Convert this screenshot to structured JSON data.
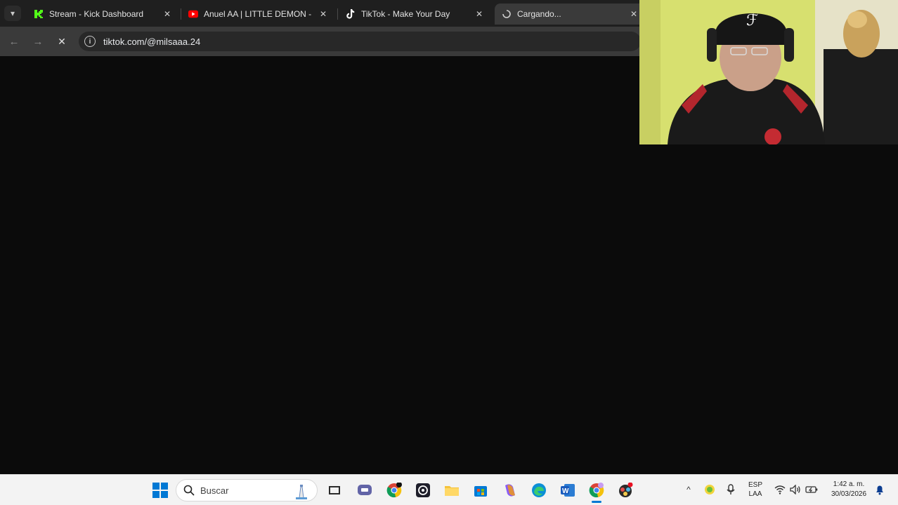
{
  "browser": {
    "tabs": [
      {
        "title": "Stream - Kick Dashboard",
        "favicon": "kick-logo-icon"
      },
      {
        "title": "Anuel AA | LITTLE DEMON - You",
        "favicon": "youtube-logo-icon"
      },
      {
        "title": "TikTok - Make Your Day",
        "favicon": "tiktok-logo-icon"
      },
      {
        "title": "Cargando...",
        "favicon": "loading-spinner-icon"
      }
    ],
    "address": "tiktok.com/@milsaaa.24"
  },
  "taskbar": {
    "search_placeholder": "Buscar",
    "language": "ESP",
    "layout": "LAA",
    "time": "1:42 a. m.",
    "date": "30/03/2026"
  },
  "colors": {
    "kick_green": "#53fc18",
    "youtube_red": "#ff0000",
    "windows_blue": "#0078d4"
  }
}
